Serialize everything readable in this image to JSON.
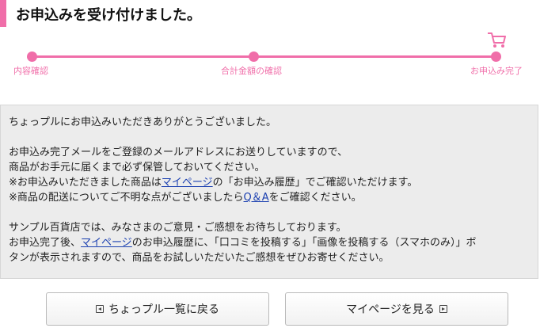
{
  "page": {
    "title": "お申込みを受け付けました。"
  },
  "steps": [
    {
      "label": "内容確認"
    },
    {
      "label": "合計金額の確認"
    },
    {
      "label": "お申込み完了"
    }
  ],
  "colors": {
    "accent": "#f06ea9",
    "link": "#1a3fb0",
    "box_bg": "#ececec"
  },
  "message": {
    "line1": "ちょっプルにお申込みいただきありがとうございました。",
    "line2": "お申込み完了メールをご登録のメールアドレスにお送りしていますので、",
    "line3": "商品がお手元に届くまで必ず保管しておいてください。",
    "line4_pre": "※お申込みいただきました商品は",
    "line4_link": "マイページ",
    "line4_post": "の「お申込み履歴」でご確認いただけます。",
    "line5_pre": "※商品の配送についてご不明な点がございましたら",
    "line5_link": "Q＆A",
    "line5_post": "をご確認ください。",
    "line6": "サンプル百貨店では、みなさまのご意見・ご感想をお待ちしております。",
    "line7_pre": "お申込完了後、",
    "line7_link": "マイページ",
    "line7_post": "のお申込履歴に、「口コミを投稿する」「画像を投稿する（スマホのみ）」ボ",
    "line8": "タンが表示されますので、商品をお試しいただいたご感想をぜひお寄せください。"
  },
  "buttons": {
    "back_label": "ちょっプル一覧に戻る",
    "mypage_label": "マイページを見る"
  },
  "icons": {
    "cart": "shopping-cart-icon",
    "back": "arrow-left-box-icon",
    "forward": "arrow-right-box-icon"
  }
}
